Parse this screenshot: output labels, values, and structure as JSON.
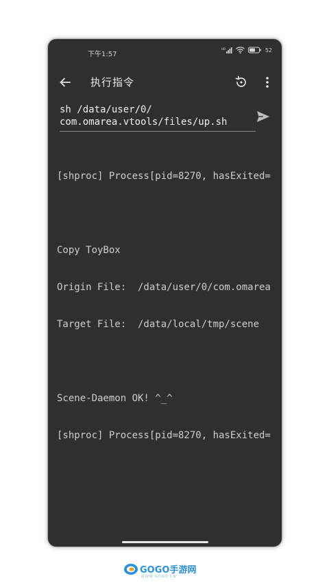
{
  "status_bar": {
    "time": "下午1:57",
    "battery": "52"
  },
  "app_bar": {
    "title": "执行指令",
    "back_icon": "arrow-left-icon",
    "history_icon": "history-icon",
    "menu_icon": "more-vert-icon"
  },
  "command": {
    "value": "sh /data/user/0/\ncom.omarea.vtools/files/up.sh",
    "send_icon": "send-icon"
  },
  "output": {
    "lines": [
      "[shproc] Process[pid=8270, hasExited=",
      "",
      "Copy ToyBox",
      "Origin File:  /data/user/0/com.omarea",
      "Target File:  /data/local/tmp/scene",
      "",
      "Scene-Daemon OK! ^_^",
      "[shproc] Process[pid=8270, hasExited="
    ]
  },
  "watermark": {
    "text": "GOGO手游网",
    "sub": "WWW.GOGO.CN"
  },
  "colors": {
    "background": "#2f2f2f",
    "text": "#cfcfcf",
    "accent": "#2b8fd8"
  }
}
